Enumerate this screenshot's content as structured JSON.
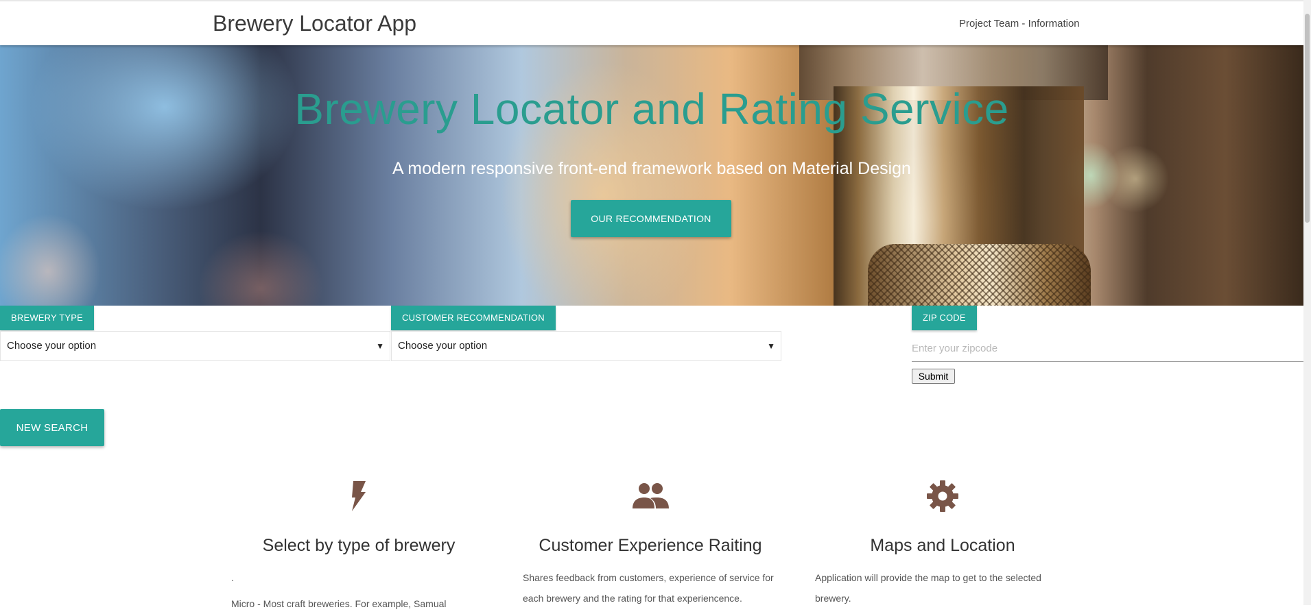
{
  "navbar": {
    "brand": "Brewery Locator App",
    "link": "Project Team - Information"
  },
  "hero": {
    "title": "Brewery Locator and Rating Service",
    "subtitle": "A modern responsive front-end framework based on Material Design",
    "button_label": "OUR RECOMMENDATION"
  },
  "filters": {
    "brewery_type": {
      "label": "BREWERY TYPE",
      "selected": "Choose your option"
    },
    "customer_recommendation": {
      "label": "CUSTOMER RECOMMENDATION",
      "selected": "Choose your option"
    },
    "zip_code": {
      "label": "ZIP CODE",
      "placeholder": "Enter your zipcode",
      "submit_label": "Submit"
    },
    "new_search_label": "NEW SEARCH"
  },
  "features": [
    {
      "icon": "flash-icon",
      "title": "Select by type of brewery",
      "text_1": ".",
      "text_2": "Micro - Most craft breweries. For example, Samual"
    },
    {
      "icon": "group-icon",
      "title": "Customer Experience Raiting",
      "text": "Shares feedback from customers, experience of service for each brewery and the rating for that experiencence."
    },
    {
      "icon": "gear-icon",
      "title": "Maps and Location",
      "text": "Application will provide the map to get to the selected brewery."
    }
  ],
  "colors": {
    "accent": "#26a69a",
    "hero_title": "#2a9d8f",
    "icon": "#795548"
  }
}
